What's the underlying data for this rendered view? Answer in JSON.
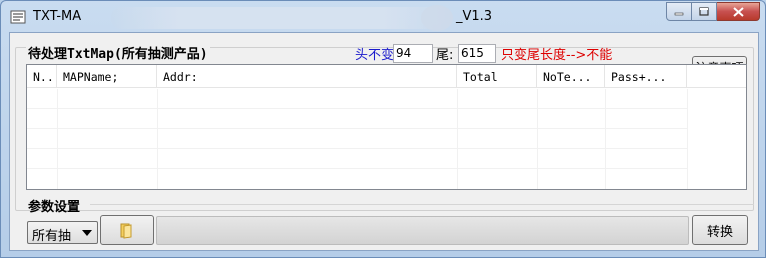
{
  "window": {
    "title_start": "TXT-MA",
    "title_version": "_V1.3"
  },
  "group": {
    "title": "待处理TxtMap(所有抽测产品)",
    "head_label": "头不变",
    "head_value": "94",
    "tail_label": "尾:",
    "tail_value": "615",
    "note": "只变尾长度-->不能",
    "notes_button": "注意事项"
  },
  "list": {
    "columns": [
      "N..",
      "MAPName;",
      "Addr:",
      "Total",
      "NoTe...",
      "Pass+..."
    ],
    "rows": []
  },
  "params": {
    "title": "参数设置",
    "scope_value": "所有抽",
    "convert_button": "转换"
  },
  "icons": {
    "app": "app-icon",
    "folder": "folder-icon",
    "minimize": "minimize-icon",
    "maximize": "maximize-icon",
    "close": "close-icon"
  },
  "colors": {
    "head_label": "#1a1acc",
    "note": "#dd0000"
  }
}
